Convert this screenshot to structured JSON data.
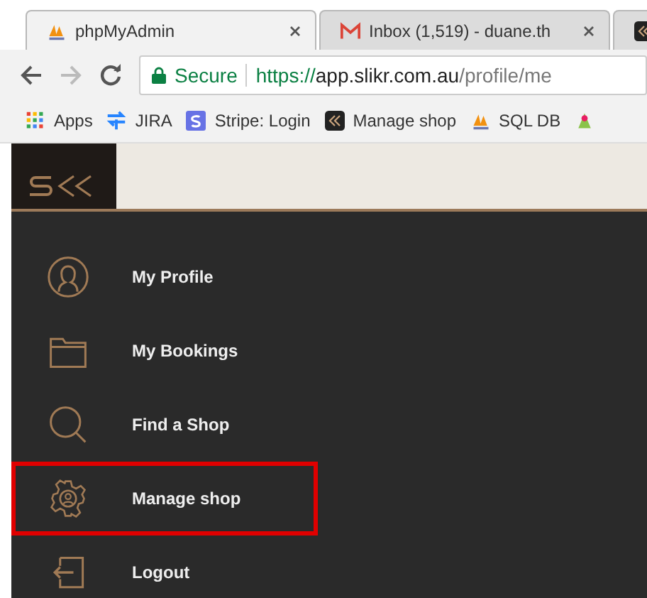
{
  "tabs": [
    {
      "title": "phpMyAdmin",
      "selected": true
    },
    {
      "title": "Inbox (1,519) - duane.th",
      "selected": false
    },
    {
      "selected": false
    }
  ],
  "address_bar": {
    "secure_label": "Secure",
    "scheme": "https://",
    "host": "app.slikr.com.au",
    "path": "/profile/me"
  },
  "bookmarks": [
    {
      "label": "Apps"
    },
    {
      "label": "JIRA"
    },
    {
      "label": "Stripe: Login"
    },
    {
      "label": "Manage shop"
    },
    {
      "label": "SQL DB"
    }
  ],
  "menu": [
    {
      "label": "My Profile",
      "highlighted": false
    },
    {
      "label": "My Bookings",
      "highlighted": false
    },
    {
      "label": "Find a Shop",
      "highlighted": false
    },
    {
      "label": "Manage shop",
      "highlighted": true
    },
    {
      "label": "Logout",
      "highlighted": false
    }
  ]
}
